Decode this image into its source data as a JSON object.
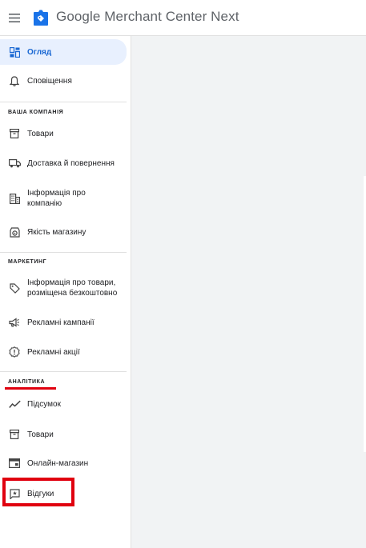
{
  "header": {
    "menu_icon": "hamburger-menu-icon",
    "logo_icon": "merchant-center-tag-icon",
    "brand": "Google",
    "product": "Merchant Center Next"
  },
  "sidebar": {
    "top_items": [
      {
        "label": "Огляд",
        "icon": "dashboard-icon",
        "active": true
      },
      {
        "label": "Сповіщення",
        "icon": "bell-icon"
      }
    ],
    "sections": [
      {
        "title": "ВАША КОМПАНІЯ",
        "items": [
          {
            "label": "Товари",
            "icon": "archive-box-icon"
          },
          {
            "label": "Доставка й повернення",
            "icon": "truck-icon"
          },
          {
            "label": "Інформація про компанію",
            "icon": "building-icon"
          },
          {
            "label": "Якість магазину",
            "icon": "store-quality-icon"
          }
        ]
      },
      {
        "title": "МАРКЕТИНГ",
        "items": [
          {
            "label": "Інформація про товари, розміщена безкоштовно",
            "icon": "tag-icon"
          },
          {
            "label": "Рекламні кампанії",
            "icon": "megaphone-icon"
          },
          {
            "label": "Рекламні акції",
            "icon": "promo-alert-icon"
          }
        ]
      },
      {
        "title": "АНАЛІТИКА",
        "items": [
          {
            "label": "Підсумок",
            "icon": "trend-line-icon"
          },
          {
            "label": "Товари",
            "icon": "archive-box-icon"
          },
          {
            "label": "Онлайн-магазин",
            "icon": "storefront-icon"
          },
          {
            "label": "Відгуки",
            "icon": "review-star-icon"
          }
        ]
      }
    ]
  },
  "annotations": {
    "highlight_color": "#e0000f"
  }
}
